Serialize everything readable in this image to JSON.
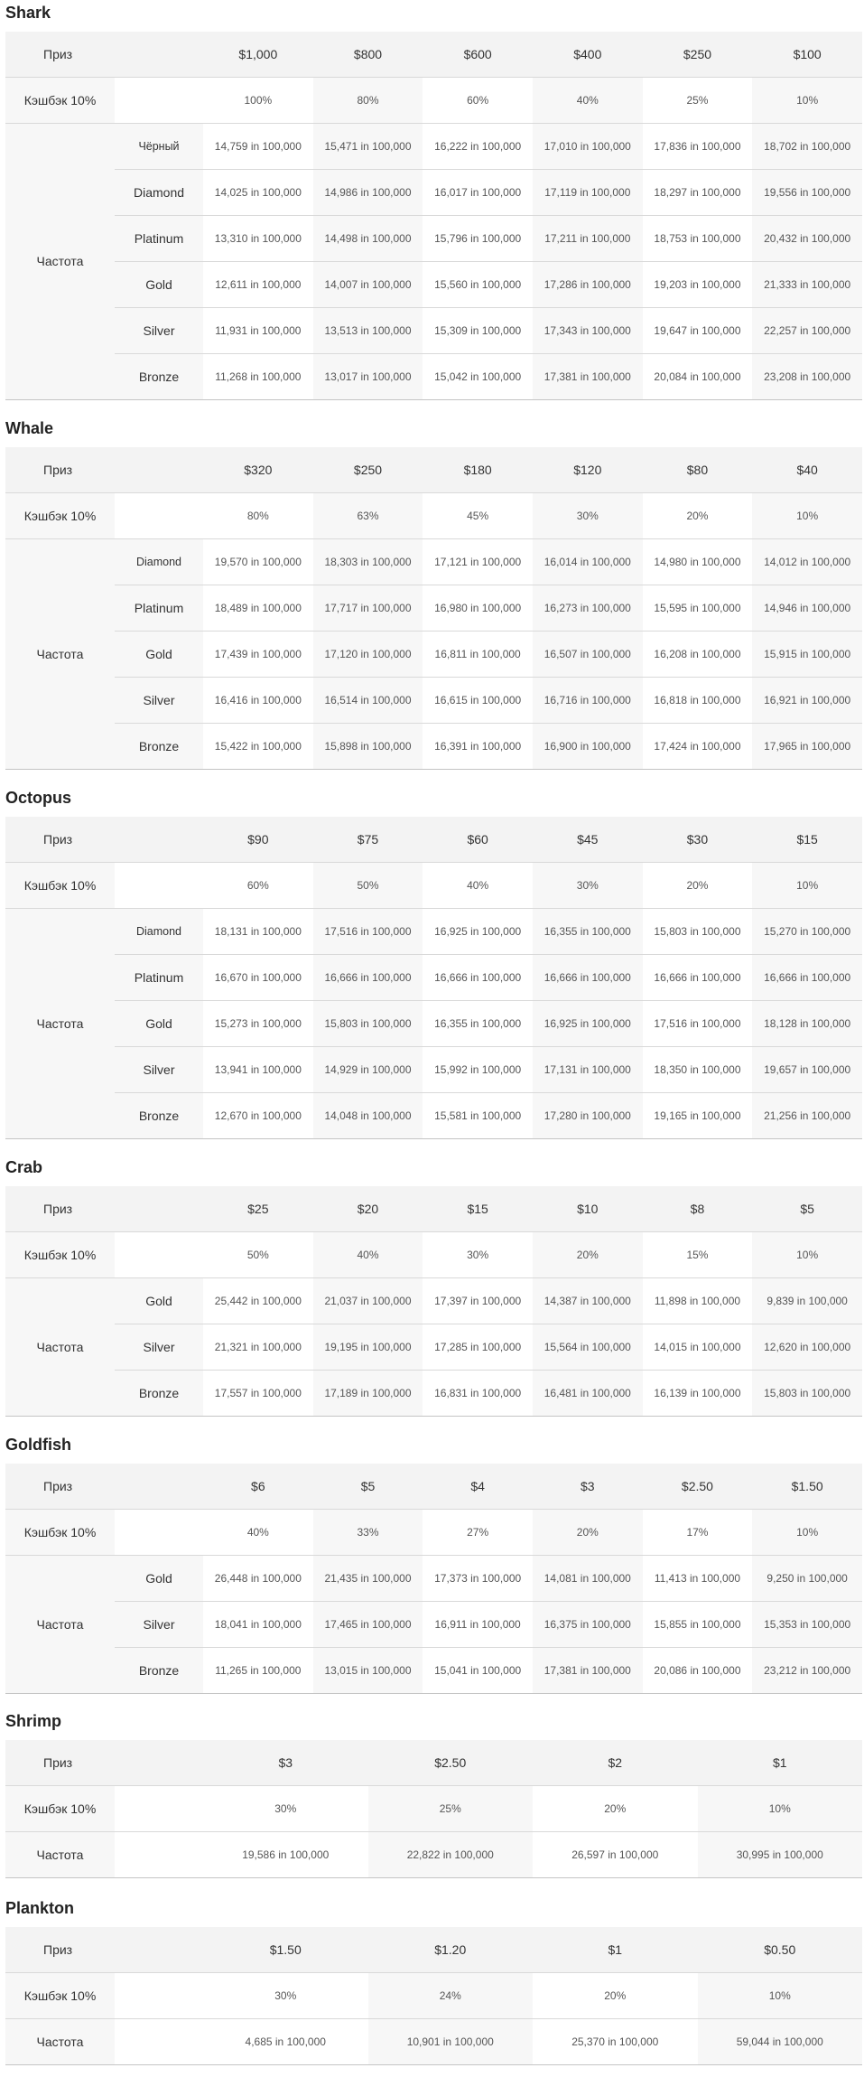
{
  "labels": {
    "prize": "Приз",
    "cashback": "Кэшбэк 10%",
    "frequency": "Частота"
  },
  "sections": [
    {
      "title": "Shark",
      "prizes": [
        "$1,000",
        "$800",
        "$600",
        "$400",
        "$250",
        "$100"
      ],
      "cashback": [
        "100%",
        "80%",
        "60%",
        "40%",
        "25%",
        "10%"
      ],
      "tiers": [
        {
          "name": "Чёрный",
          "values": [
            "14,759 in 100,000",
            "15,471 in 100,000",
            "16,222 in 100,000",
            "17,010 in 100,000",
            "17,836 in 100,000",
            "18,702 in 100,000"
          ]
        },
        {
          "name": "Diamond",
          "values": [
            "14,025 in 100,000",
            "14,986 in 100,000",
            "16,017 in 100,000",
            "17,119 in 100,000",
            "18,297 in 100,000",
            "19,556 in 100,000"
          ]
        },
        {
          "name": "Platinum",
          "values": [
            "13,310 in 100,000",
            "14,498 in 100,000",
            "15,796 in 100,000",
            "17,211 in 100,000",
            "18,753 in 100,000",
            "20,432 in 100,000"
          ]
        },
        {
          "name": "Gold",
          "values": [
            "12,611 in 100,000",
            "14,007 in 100,000",
            "15,560 in 100,000",
            "17,286 in 100,000",
            "19,203 in 100,000",
            "21,333 in 100,000"
          ]
        },
        {
          "name": "Silver",
          "values": [
            "11,931 in 100,000",
            "13,513 in 100,000",
            "15,309 in 100,000",
            "17,343 in 100,000",
            "19,647 in 100,000",
            "22,257 in 100,000"
          ]
        },
        {
          "name": "Bronze",
          "values": [
            "11,268 in 100,000",
            "13,017 in 100,000",
            "15,042 in 100,000",
            "17,381 in 100,000",
            "20,084 in 100,000",
            "23,208 in 100,000"
          ]
        }
      ]
    },
    {
      "title": "Whale",
      "prizes": [
        "$320",
        "$250",
        "$180",
        "$120",
        "$80",
        "$40"
      ],
      "cashback": [
        "80%",
        "63%",
        "45%",
        "30%",
        "20%",
        "10%"
      ],
      "tiers": [
        {
          "name": "Diamond",
          "values": [
            "19,570 in 100,000",
            "18,303 in 100,000",
            "17,121 in 100,000",
            "16,014 in 100,000",
            "14,980 in 100,000",
            "14,012 in 100,000"
          ]
        },
        {
          "name": "Platinum",
          "values": [
            "18,489 in 100,000",
            "17,717 in 100,000",
            "16,980 in 100,000",
            "16,273 in 100,000",
            "15,595 in 100,000",
            "14,946 in 100,000"
          ]
        },
        {
          "name": "Gold",
          "values": [
            "17,439 in 100,000",
            "17,120 in 100,000",
            "16,811 in 100,000",
            "16,507 in 100,000",
            "16,208 in 100,000",
            "15,915 in 100,000"
          ]
        },
        {
          "name": "Silver",
          "values": [
            "16,416 in 100,000",
            "16,514 in 100,000",
            "16,615 in 100,000",
            "16,716 in 100,000",
            "16,818 in 100,000",
            "16,921 in 100,000"
          ]
        },
        {
          "name": "Bronze",
          "values": [
            "15,422 in 100,000",
            "15,898 in 100,000",
            "16,391 in 100,000",
            "16,900 in 100,000",
            "17,424 in 100,000",
            "17,965 in 100,000"
          ]
        }
      ]
    },
    {
      "title": "Octopus",
      "prizes": [
        "$90",
        "$75",
        "$60",
        "$45",
        "$30",
        "$15"
      ],
      "cashback": [
        "60%",
        "50%",
        "40%",
        "30%",
        "20%",
        "10%"
      ],
      "tiers": [
        {
          "name": "Diamond",
          "values": [
            "18,131 in 100,000",
            "17,516 in 100,000",
            "16,925 in 100,000",
            "16,355 in 100,000",
            "15,803 in 100,000",
            "15,270 in 100,000"
          ]
        },
        {
          "name": "Platinum",
          "values": [
            "16,670 in 100,000",
            "16,666 in 100,000",
            "16,666 in 100,000",
            "16,666 in 100,000",
            "16,666 in 100,000",
            "16,666 in 100,000"
          ]
        },
        {
          "name": "Gold",
          "values": [
            "15,273 in 100,000",
            "15,803 in 100,000",
            "16,355 in 100,000",
            "16,925 in 100,000",
            "17,516 in 100,000",
            "18,128 in 100,000"
          ]
        },
        {
          "name": "Silver",
          "values": [
            "13,941 in 100,000",
            "14,929 in 100,000",
            "15,992 in 100,000",
            "17,131 in 100,000",
            "18,350 in 100,000",
            "19,657 in 100,000"
          ]
        },
        {
          "name": "Bronze",
          "values": [
            "12,670 in 100,000",
            "14,048 in 100,000",
            "15,581 in 100,000",
            "17,280 in 100,000",
            "19,165 in 100,000",
            "21,256 in 100,000"
          ]
        }
      ]
    },
    {
      "title": "Crab",
      "prizes": [
        "$25",
        "$20",
        "$15",
        "$10",
        "$8",
        "$5"
      ],
      "cashback": [
        "50%",
        "40%",
        "30%",
        "20%",
        "15%",
        "10%"
      ],
      "tiers": [
        {
          "name": "Gold",
          "values": [
            "25,442 in 100,000",
            "21,037 in 100,000",
            "17,397 in 100,000",
            "14,387 in 100,000",
            "11,898 in 100,000",
            "9,839 in 100,000"
          ]
        },
        {
          "name": "Silver",
          "values": [
            "21,321 in 100,000",
            "19,195 in 100,000",
            "17,285 in 100,000",
            "15,564 in 100,000",
            "14,015 in 100,000",
            "12,620 in 100,000"
          ]
        },
        {
          "name": "Bronze",
          "values": [
            "17,557 in 100,000",
            "17,189 in 100,000",
            "16,831 in 100,000",
            "16,481 in 100,000",
            "16,139 in 100,000",
            "15,803 in 100,000"
          ]
        }
      ]
    },
    {
      "title": "Goldfish",
      "prizes": [
        "$6",
        "$5",
        "$4",
        "$3",
        "$2.50",
        "$1.50"
      ],
      "cashback": [
        "40%",
        "33%",
        "27%",
        "20%",
        "17%",
        "10%"
      ],
      "tiers": [
        {
          "name": "Gold",
          "values": [
            "26,448 in 100,000",
            "21,435 in 100,000",
            "17,373 in 100,000",
            "14,081 in 100,000",
            "11,413 in 100,000",
            "9,250 in 100,000"
          ]
        },
        {
          "name": "Silver",
          "values": [
            "18,041 in 100,000",
            "17,465 in 100,000",
            "16,911 in 100,000",
            "16,375 in 100,000",
            "15,855 in 100,000",
            "15,353 in 100,000"
          ]
        },
        {
          "name": "Bronze",
          "values": [
            "11,265 in 100,000",
            "13,015 in 100,000",
            "15,041 in 100,000",
            "17,381 in 100,000",
            "20,086 in 100,000",
            "23,212 in 100,000"
          ]
        }
      ]
    },
    {
      "title": "Shrimp",
      "prizes": [
        "$3",
        "$2.50",
        "$2",
        "$1"
      ],
      "cashback": [
        "30%",
        "25%",
        "20%",
        "10%"
      ],
      "frequency": [
        "19,586 in 100,000",
        "22,822 in 100,000",
        "26,597 in 100,000",
        "30,995 in 100,000"
      ]
    },
    {
      "title": "Plankton",
      "prizes": [
        "$1.50",
        "$1.20",
        "$1",
        "$0.50"
      ],
      "cashback": [
        "30%",
        "24%",
        "20%",
        "10%"
      ],
      "frequency": [
        "4,685 in 100,000",
        "10,901 in 100,000",
        "25,370 in 100,000",
        "59,044 in 100,000"
      ]
    }
  ]
}
